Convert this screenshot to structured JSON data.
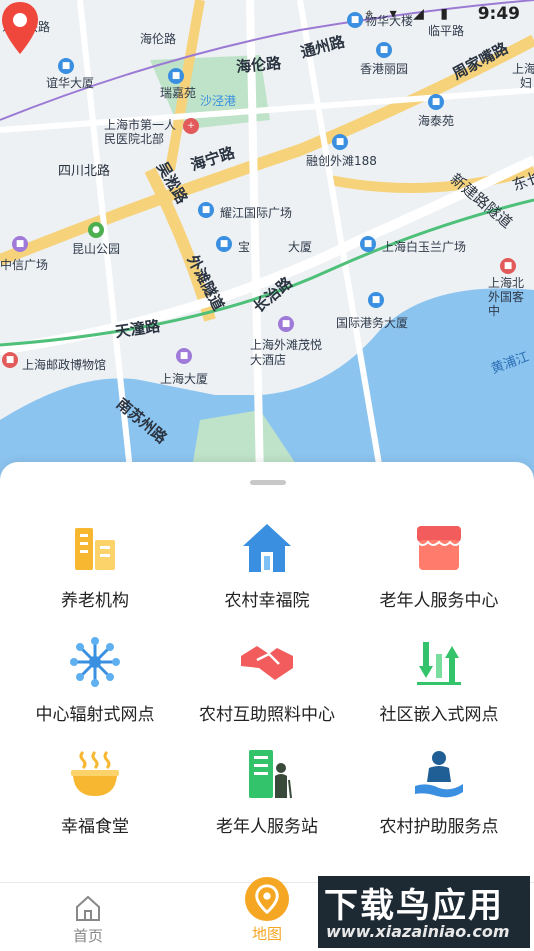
{
  "status_bar": {
    "time": "9:49",
    "icons": [
      "location-icon",
      "wifi-icon",
      "signal-icon",
      "battery-icon"
    ]
  },
  "map": {
    "roads": [
      "海伦路",
      "通州路",
      "周家嘴路",
      "吴淞路",
      "海宁路",
      "四川北路",
      "外滩隧道",
      "长治路",
      "天潼路",
      "南苏州路",
      "新建路隧道",
      "东长",
      "黄浦江"
    ],
    "pois": [
      "东宝兴路",
      "海伦路",
      "物华大楼",
      "临平路",
      "谊华大厦",
      "瑞嘉苑",
      "沙泾港",
      "香港丽园",
      "上海",
      "上海市第一人民医院北部",
      "海泰苑",
      "融创外滩188",
      "耀江国际广场",
      "昆山公园",
      "中信广场",
      "宝",
      "大厦",
      "上海白玉兰广场",
      "上海北外国客中",
      "国际港务大厦",
      "上海外滩茂悦大酒店",
      "上海邮政博物馆",
      "上海大厦",
      "妇"
    ]
  },
  "services": [
    {
      "label": "养老机构",
      "icon": "building-icon",
      "color": "#f7b731"
    },
    {
      "label": "农村幸福院",
      "icon": "house-icon",
      "color": "#3a8fe0"
    },
    {
      "label": "老年人服务中心",
      "icon": "store-icon",
      "color": "#f25c5c"
    },
    {
      "label": "中心辐射式网点",
      "icon": "network-icon",
      "color": "#3a8fe0"
    },
    {
      "label": "农村互助照料中心",
      "icon": "handshake-icon",
      "color": "#f25c5c"
    },
    {
      "label": "社区嵌入式网点",
      "icon": "arrows-icon",
      "color": "#33c36a"
    },
    {
      "label": "幸福食堂",
      "icon": "bowl-icon",
      "color": "#f7b731"
    },
    {
      "label": "老年人服务站",
      "icon": "elder-station-icon",
      "color": "#33c36a"
    },
    {
      "label": "农村护助服务点",
      "icon": "care-hand-icon",
      "color": "#3a8fe0"
    }
  ],
  "tabs": [
    {
      "label": "首页",
      "icon": "home-icon"
    },
    {
      "label": "地图",
      "icon": "map-pin-icon",
      "active": true
    }
  ],
  "watermark": {
    "line1": "下载鸟应用",
    "line2": "www.xiazainiao.com"
  },
  "colors": {
    "accent": "#f5a623",
    "pin": "#f0473c",
    "water": "#8cc4f0"
  }
}
